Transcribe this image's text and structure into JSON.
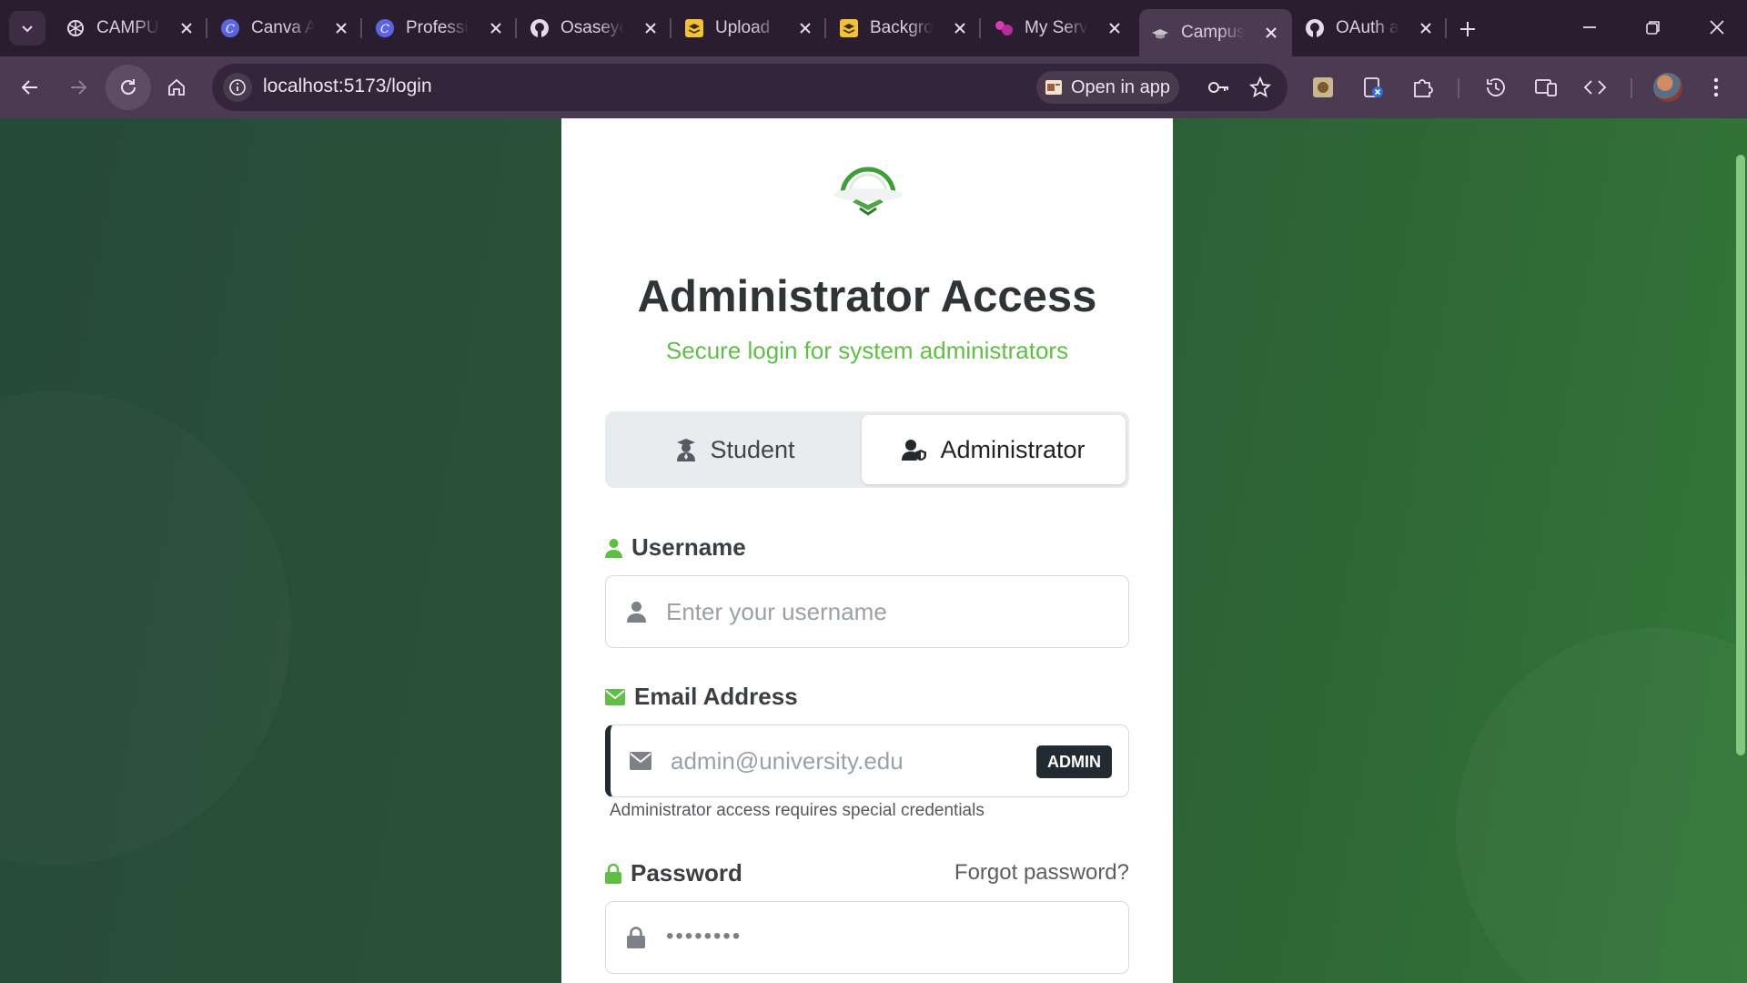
{
  "browser": {
    "tabs": [
      {
        "title": "CAMPUS",
        "favicon": "openai-icon"
      },
      {
        "title": "Canva AI",
        "favicon": "canva-icon"
      },
      {
        "title": "Professional",
        "favicon": "canva-icon"
      },
      {
        "title": "Osaseye",
        "favicon": "github-icon"
      },
      {
        "title": "Upload",
        "favicon": "layers-icon"
      },
      {
        "title": "Background",
        "favicon": "layers-icon"
      },
      {
        "title": "My Services",
        "favicon": "app-icon"
      },
      {
        "title": "Campus",
        "favicon": "campus-icon",
        "active": true
      },
      {
        "title": "OAuth app",
        "favicon": "github-icon"
      }
    ],
    "url": "localhost:5173/login",
    "open_in_app_label": "Open in app"
  },
  "page": {
    "heading": "Administrator Access",
    "subheading": "Secure login for system administrators",
    "roles": {
      "student_label": "Student",
      "admin_label": "Administrator",
      "selected": "Administrator"
    },
    "username": {
      "label": "Username",
      "placeholder": "Enter your username"
    },
    "email": {
      "label": "Email Address",
      "placeholder": "admin@university.edu",
      "badge": "ADMIN",
      "hint": "Administrator access requires special credentials"
    },
    "password": {
      "label": "Password",
      "forgot_label": "Forgot password?",
      "value_masked": "••••••••"
    }
  },
  "colors": {
    "accent_green": "#5fbf45",
    "dark_badge": "#212b31",
    "heading": "#2f3436"
  }
}
